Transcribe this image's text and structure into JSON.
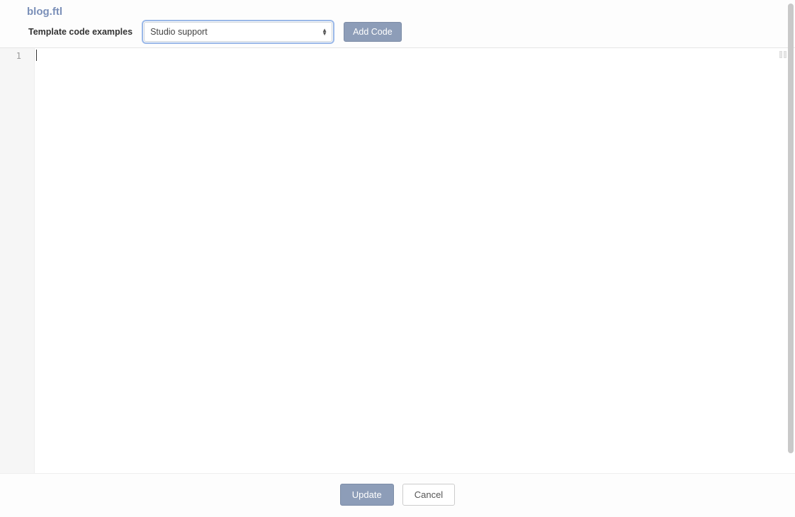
{
  "header": {
    "title": "blog.ftl",
    "template_label": "Template code examples",
    "select_value": "Studio support",
    "add_code_label": "Add Code"
  },
  "editor": {
    "line_numbers": [
      "1"
    ],
    "content": ""
  },
  "footer": {
    "update_label": "Update",
    "cancel_label": "Cancel"
  }
}
